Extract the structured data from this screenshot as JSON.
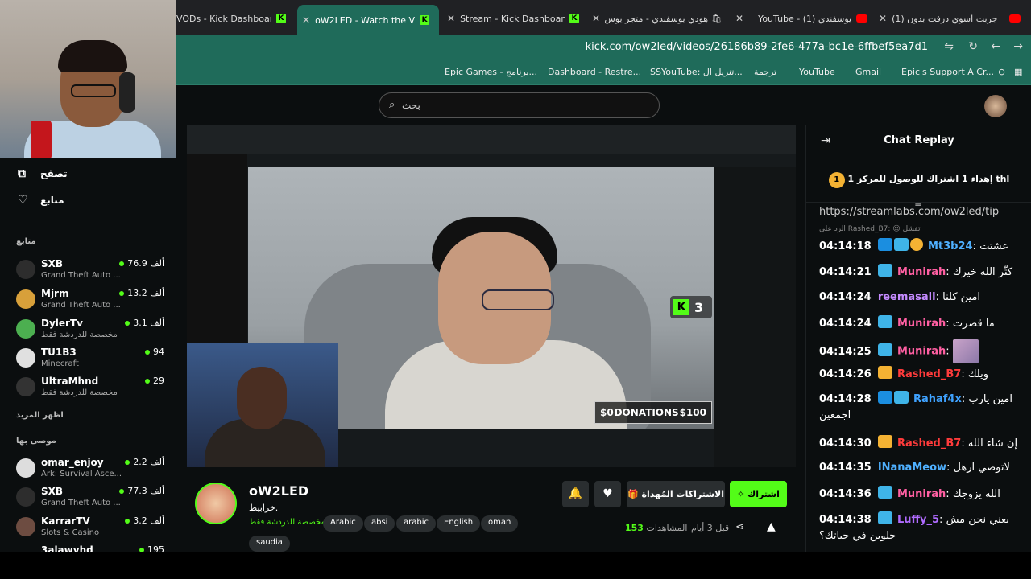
{
  "tabs": [
    {
      "label": "VODs - Kick Dashboard",
      "icon": "kick-icon"
    },
    {
      "label": "oW2LED - Watch the V",
      "icon": "kick-icon",
      "active": true
    },
    {
      "label": "Stream - Kick Dashboard",
      "icon": "kick-icon"
    },
    {
      "label": "هودي يوسفندي - متجر يوس",
      "icon": "shop-icon"
    },
    {
      "label": "YouTube - (1) يوسفندي",
      "icon": "youtube-icon"
    },
    {
      "label": "(1) جربت اسوي درفت بدون",
      "icon": "youtube-icon"
    }
  ],
  "address": {
    "url": "kick.com/ow2led/videos/26186b89-2fe6-477a-bc1e-6ffbef5ea7d1"
  },
  "bookmarks": [
    "Epic's Support A Cr...",
    "Gmail",
    "YouTube",
    "ترجمة",
    "SSYouTube: تنزيل ال...",
    "Dashboard - Restre...",
    "Epic Games - برنامج..."
  ],
  "search": {
    "placeholder": "بحث"
  },
  "sidebar": {
    "browse": "تصفح",
    "following": "متابع",
    "following_header": "متابع",
    "show_more": "اظهر المزيد",
    "recommended_header": "موصى بها",
    "channels": [
      {
        "name": "SXB",
        "game": "Grand Theft Auto ...",
        "viewers": "76.9 ألف"
      },
      {
        "name": "Mjrm",
        "game": "Grand Theft Auto ...",
        "viewers": "13.2 ألف"
      },
      {
        "name": "DylerTv",
        "game": "مخصصة للدردشة فقط",
        "viewers": "3.1 ألف"
      },
      {
        "name": "TU1B3",
        "game": "Minecraft",
        "viewers": "94"
      },
      {
        "name": "UltraMhnd",
        "game": "مخصصة للدردشة فقط",
        "viewers": "29"
      }
    ],
    "recommended": [
      {
        "name": "omar_enjoy",
        "game": "Ark: Survival Asce...",
        "viewers": "2.2 ألف"
      },
      {
        "name": "SXB",
        "game": "Grand Theft Auto ...",
        "viewers": "77.3 ألف"
      },
      {
        "name": "KarrarTV",
        "game": "Slots & Casino",
        "viewers": "3.2 ألف"
      },
      {
        "name": "3alawyhd",
        "game": "",
        "viewers": "195"
      }
    ]
  },
  "video": {
    "kick_count": "3",
    "donations_left": "$0",
    "donations_label": "DONATIONS",
    "donations_right": "$100"
  },
  "channel": {
    "name": "oW2LED",
    "subtitle": "خرابيط.",
    "category": "مخصصة للدردشة فقط",
    "tags": [
      "oman",
      "English",
      "arabic",
      "absi",
      "Arabic",
      "saudia"
    ],
    "subscribe_label": "اشتراك",
    "gift_label": "الاشتراكات المُهداة",
    "views": "153",
    "views_label": "المشاهدات",
    "ago": "قبل 3 أيام"
  },
  "chat": {
    "title": "Chat Replay",
    "pinned": "إهداء 1 اشتراك للوصول للمركز 1 thا",
    "pinned_medal": "1",
    "link": "https://streamlabs.com/ow2led/tip",
    "reply_to": "الرد على Rashed_B7: ☺ تفشل",
    "messages": [
      {
        "time": "04:14:18",
        "user": "Mt3b24",
        "color": "#4fb0ff",
        "text": "عشتت",
        "badges": [
          "b-mod",
          "b-og",
          "b-gold"
        ]
      },
      {
        "time": "04:14:21",
        "user": "Munirah",
        "color": "#ff5fa2",
        "text": "كثّر الله خيرك",
        "badges": [
          "b-og"
        ]
      },
      {
        "time": "04:14:24",
        "user": "reemasall",
        "color": "#c58bff",
        "text": "امين كلنا",
        "badges": []
      },
      {
        "time": "04:14:24",
        "user": "Munirah",
        "color": "#ff5fa2",
        "text": "ما قصرت",
        "badges": [
          "b-og"
        ]
      },
      {
        "time": "04:14:25",
        "user": "Munirah",
        "color": "#ff5fa2",
        "text": "",
        "emote": true,
        "badges": [
          "b-og"
        ]
      },
      {
        "time": "04:14:26",
        "user": "Rashed_B7",
        "color": "#ff3b3b",
        "text": "ويلك",
        "badges": [
          "b-crown"
        ]
      },
      {
        "time": "04:14:28",
        "user": "Rahaf4x",
        "color": "#3fa2ff",
        "text": "امين يارب اجمعين",
        "badges": [
          "b-mod",
          "b-og"
        ]
      },
      {
        "time": "04:14:30",
        "user": "Rashed_B7",
        "color": "#ff3b3b",
        "text": "إن شاء الله",
        "badges": [
          "b-crown"
        ]
      },
      {
        "time": "04:14:35",
        "user": "INanaMeow",
        "color": "#4fb0ff",
        "text": "لاتوصي ازهل",
        "badges": []
      },
      {
        "time": "04:14:36",
        "user": "Munirah",
        "color": "#ff5fa2",
        "text": "الله يزوجك",
        "badges": [
          "b-og"
        ]
      },
      {
        "time": "04:14:38",
        "user": "Luffy_5",
        "color": "#b06bff",
        "text": "يعني نحن مش حلوين في حياتك؟",
        "badges": [
          "b-og"
        ]
      }
    ]
  }
}
